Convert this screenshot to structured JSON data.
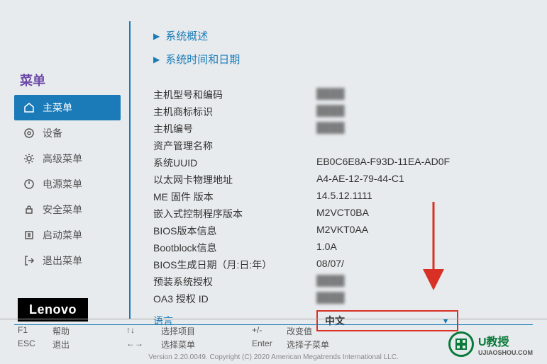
{
  "sidebar": {
    "title": "菜单",
    "items": [
      {
        "label": "主菜单",
        "icon": "home-icon",
        "active": true
      },
      {
        "label": "设备",
        "icon": "device-icon",
        "active": false
      },
      {
        "label": "高级菜单",
        "icon": "gear-icon",
        "active": false
      },
      {
        "label": "电源菜单",
        "icon": "power-icon",
        "active": false
      },
      {
        "label": "安全菜单",
        "icon": "lock-icon",
        "active": false
      },
      {
        "label": "启动菜单",
        "icon": "boot-icon",
        "active": false
      },
      {
        "label": "退出菜单",
        "icon": "exit-icon",
        "active": false
      }
    ]
  },
  "nav": {
    "overview": "系统概述",
    "datetime": "系统时间和日期"
  },
  "info": [
    {
      "label": "主机型号和编码",
      "value": "████",
      "blurred": true
    },
    {
      "label": "主机商标标识",
      "value": "████",
      "blurred": true
    },
    {
      "label": "主机编号",
      "value": "████",
      "blurred": true
    },
    {
      "label": "资产管理名称",
      "value": "",
      "blurred": false
    },
    {
      "label": "系统UUID",
      "value": "EB0C6E8A-F93D-11EA-AD0F",
      "blurred": false
    },
    {
      "label": "以太网卡物理地址",
      "value": "A4-AE-12-79-44-C1",
      "blurred": false
    },
    {
      "label": "ME 固件 版本",
      "value": "14.5.12.1111",
      "blurred": false
    },
    {
      "label": "嵌入式控制程序版本",
      "value": "M2VCT0BA",
      "blurred": false
    },
    {
      "label": "BIOS版本信息",
      "value": "M2VKT0AA",
      "blurred": false
    },
    {
      "label": "Bootblock信息",
      "value": "1.0A",
      "blurred": false
    },
    {
      "label": "BIOS生成日期（月:日:年）",
      "value": "08/07/",
      "blurred": false
    },
    {
      "label": "预装系统授权",
      "value": "████",
      "blurred": true
    },
    {
      "label": "OA3 授权 ID",
      "value": "████",
      "blurred": true
    }
  ],
  "language": {
    "label": "语言",
    "value": "中文"
  },
  "brand": "Lenovo",
  "footer": {
    "keys": [
      [
        {
          "key": "F1",
          "desc": "帮助"
        },
        {
          "key": "ESC",
          "desc": "退出"
        }
      ],
      [
        {
          "key": "↑↓",
          "desc": "选择项目"
        },
        {
          "key": "←→",
          "desc": "选择菜单"
        }
      ],
      [
        {
          "key": "+/-",
          "desc": "改变值"
        },
        {
          "key": "Enter",
          "desc": "选择子菜单"
        }
      ]
    ],
    "copyright": "Version 2.20.0049. Copyright (C) 2020 American Megatrends International LLC."
  },
  "watermark": {
    "text": "U教授",
    "sub": "UJIAOSHOU.COM"
  }
}
